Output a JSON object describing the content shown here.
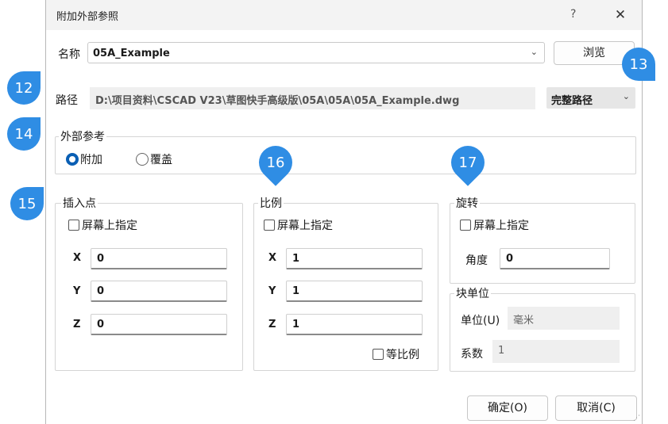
{
  "window": {
    "title": "附加外部参照",
    "help": "?",
    "close": "✕"
  },
  "name_row": {
    "label": "名称",
    "value": "05A_Example",
    "browse": "浏览"
  },
  "path_row": {
    "label": "路径",
    "value": "D:\\项目资料\\CSCAD V23\\草图快手高级版\\05A\\05A\\05A_Example.dwg",
    "mode": "完整路径"
  },
  "xref": {
    "legend": "外部参考",
    "options": [
      "附加",
      "覆盖"
    ],
    "selected": "附加"
  },
  "insert": {
    "legend": "插入点",
    "specify": "屏幕上指定",
    "x_label": "X",
    "x": "0",
    "y_label": "Y",
    "y": "0",
    "z_label": "Z",
    "z": "0"
  },
  "scale": {
    "legend": "比例",
    "specify": "屏幕上指定",
    "x_label": "X",
    "x": "1",
    "y_label": "Y",
    "y": "1",
    "z_label": "Z",
    "z": "1",
    "uniform": "等比例"
  },
  "rotation": {
    "legend": "旋转",
    "specify": "屏幕上指定",
    "angle_label": "角度",
    "angle": "0"
  },
  "units": {
    "legend": "块单位",
    "unit_label": "单位(U)",
    "unit": "毫米",
    "factor_label": "系数",
    "factor": "1"
  },
  "buttons": {
    "ok": "确定(O)",
    "cancel": "取消(C)"
  },
  "callouts": [
    "12",
    "13",
    "14",
    "15",
    "16",
    "17"
  ],
  "colors": {
    "callout": "#2f8de4",
    "radio_selected": "#0a5fb4",
    "readonly_bg": "#efefef"
  }
}
